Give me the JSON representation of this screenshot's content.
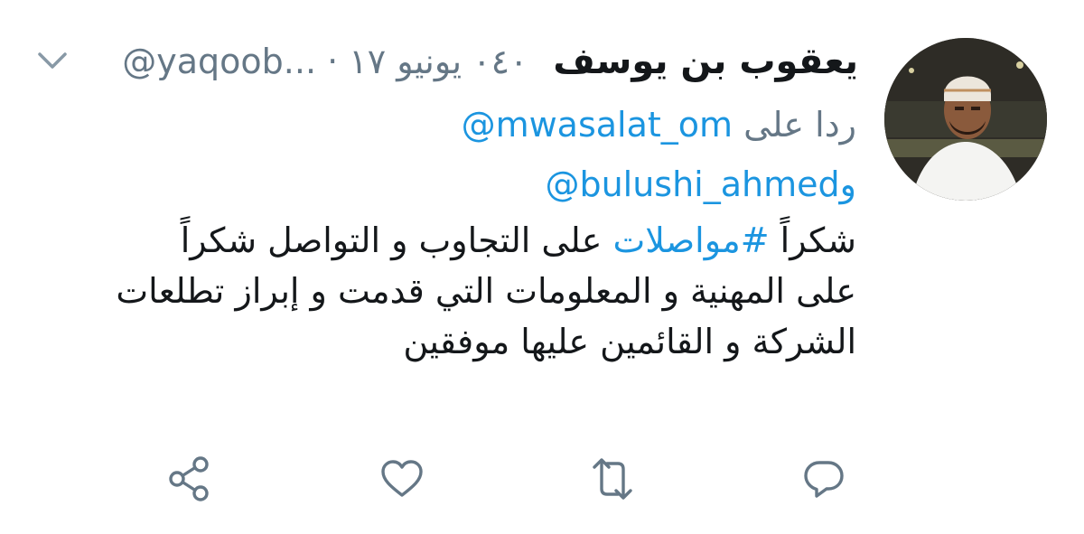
{
  "tweet": {
    "display_name": "يعقوب بن يوسف",
    "meta": "@yaqoob... · ٠٤٠ يونيو ١٧",
    "reply_label": "ردا على",
    "reply_mention_1": "@mwasalat_om",
    "reply_conj": "و",
    "reply_mention_2": "@bulushi_ahmed",
    "body": {
      "line1_prefix": "شكراً ",
      "hashtag": "#مواصلات",
      "line1_suffix": " على التجاوب و التواصل شكراً",
      "line2": "على المهنية و المعلومات التي قدمت و إبراز تطلعات",
      "line3": "الشركة و القائمين عليها موفقين"
    }
  },
  "icons": {
    "caret": "chevron-down-icon",
    "reply": "reply-icon",
    "retweet": "retweet-icon",
    "like": "heart-icon",
    "share": "share-icon"
  },
  "colors": {
    "link": "#1b95e0",
    "muted": "#657786",
    "text": "#14171a",
    "icon": "#657786"
  }
}
